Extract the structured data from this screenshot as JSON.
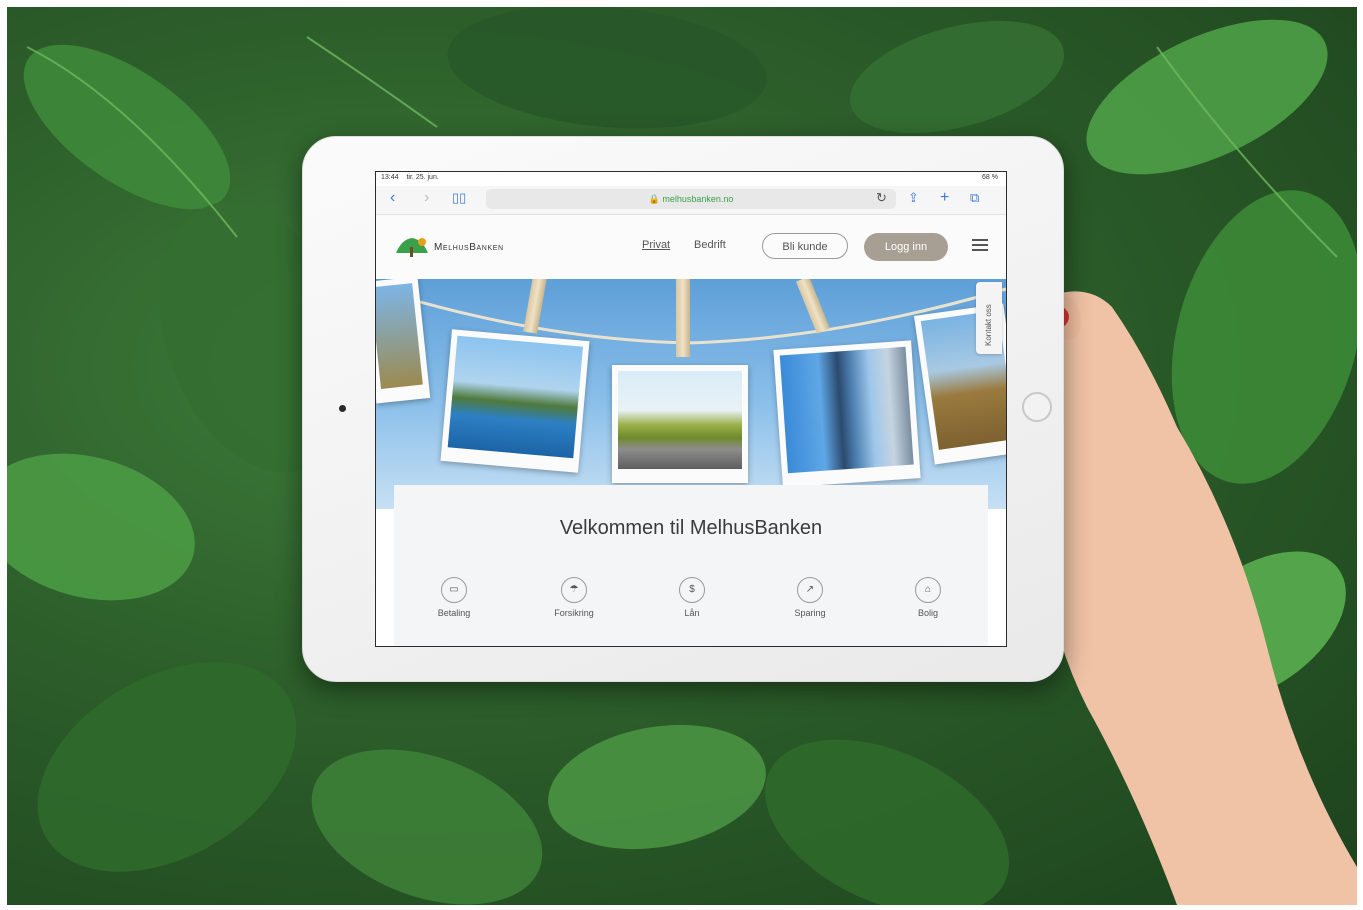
{
  "status_bar": {
    "time": "13:44",
    "date": "tir. 25. jun.",
    "battery": "68 %"
  },
  "browser": {
    "url": "melhusbanken.no"
  },
  "site": {
    "logo_text": "MelhusBanken",
    "nav": [
      {
        "label": "Privat",
        "active": true
      },
      {
        "label": "Bedrift",
        "active": false
      }
    ],
    "cta_outline": "Bli kunde",
    "cta_primary": "Logg inn",
    "contact_tab": "Kontakt oss",
    "welcome": "Velkommen til MelhusBanken",
    "categories": [
      {
        "label": "Betaling",
        "icon": "card-icon"
      },
      {
        "label": "Forsikring",
        "icon": "umbrella-icon"
      },
      {
        "label": "Lån",
        "icon": "money-bag-icon"
      },
      {
        "label": "Sparing",
        "icon": "growth-chart-icon"
      },
      {
        "label": "Bolig",
        "icon": "house-icon"
      }
    ]
  },
  "colors": {
    "foliage": "#2c5e2a",
    "accent_green": "#3aa04a",
    "primary_button": "#a79f94",
    "nail_polish": "#d8342f"
  }
}
